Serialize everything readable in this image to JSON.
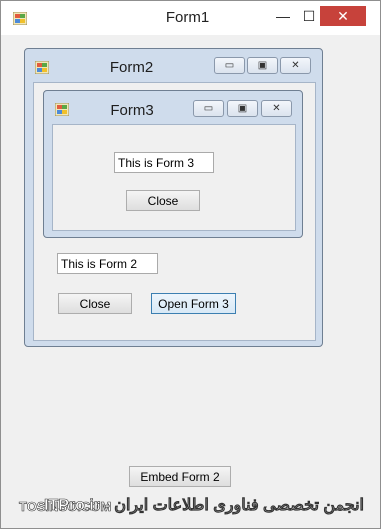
{
  "form1": {
    "title": "Form1",
    "controls": {
      "minimize": "—",
      "maximize": "☐",
      "close": "✕"
    },
    "embed_button": "Embed Form 2"
  },
  "form2": {
    "title": "Form2",
    "textbox_value": "This is Form 2",
    "close_button": "Close",
    "open_form3_button": "Open Form 3",
    "controls": {
      "minimize": "▭",
      "maximize": "▣",
      "close": "✕"
    }
  },
  "form3": {
    "title": "Form3",
    "textbox_value": "This is Form 3",
    "close_button": "Close",
    "controls": {
      "minimize": "▭",
      "maximize": "▣",
      "close": "✕"
    }
  },
  "watermark": {
    "left": "TOSINSO.COM",
    "right": "انجمن تخصصی فناوری اطلاعات ایران - ITPro.ir"
  },
  "colors": {
    "close_red": "#c7423b",
    "child_frame": "#cfdcec",
    "focus_blue": "#3c7fb1"
  }
}
